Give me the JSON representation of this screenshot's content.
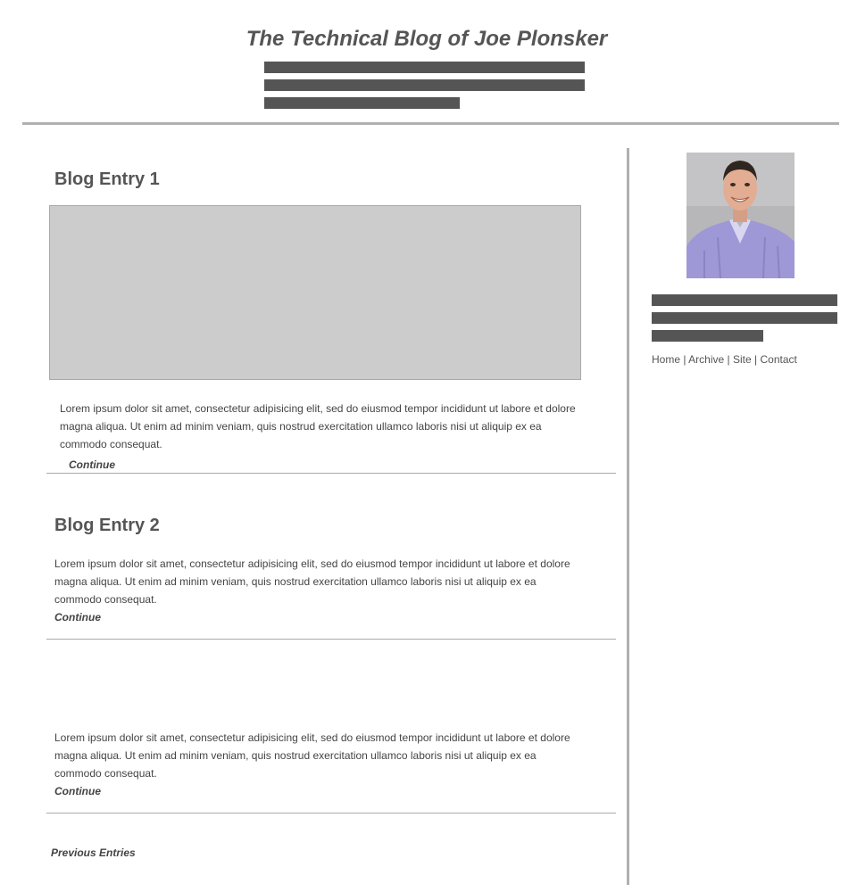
{
  "header": {
    "title": "The Technical Blog of Joe Plonsker"
  },
  "entries": [
    {
      "title": "Blog Entry 1",
      "text": "Lorem ipsum dolor sit amet, consectetur adipisicing elit, sed do eiusmod tempor incididunt ut labore et dolore magna aliqua. Ut enim ad minim veniam, quis nostrud exercitation ullamco laboris nisi ut aliquip ex ea commodo consequat.",
      "continue_label": "Continue"
    },
    {
      "title": "Blog Entry 2",
      "text": "Lorem ipsum dolor sit amet, consectetur adipisicing elit, sed do eiusmod tempor incididunt ut labore et dolore magna aliqua. Ut enim ad minim veniam, quis nostrud exercitation ullamco laboris nisi ut aliquip ex ea commodo consequat.",
      "continue_label": "Continue"
    },
    {
      "title": "",
      "text": "Lorem ipsum dolor sit amet, consectetur adipisicing elit, sed do eiusmod tempor incididunt ut labore et dolore magna aliqua. Ut enim ad minim veniam, quis nostrud exercitation ullamco laboris nisi ut aliquip ex ea commodo consequat.",
      "continue_label": "Continue"
    }
  ],
  "pagination": {
    "previous_label": "Previous Entries"
  },
  "sidebar": {
    "nav": [
      {
        "label": "Home"
      },
      {
        "label": "Archive"
      },
      {
        "label": "Site"
      },
      {
        "label": "Contact"
      }
    ],
    "separator": "|"
  },
  "colors": {
    "text": "#555555",
    "placeholder_bar": "#555555",
    "divider": "#b0b0b0",
    "image_placeholder": "#cccccc"
  }
}
